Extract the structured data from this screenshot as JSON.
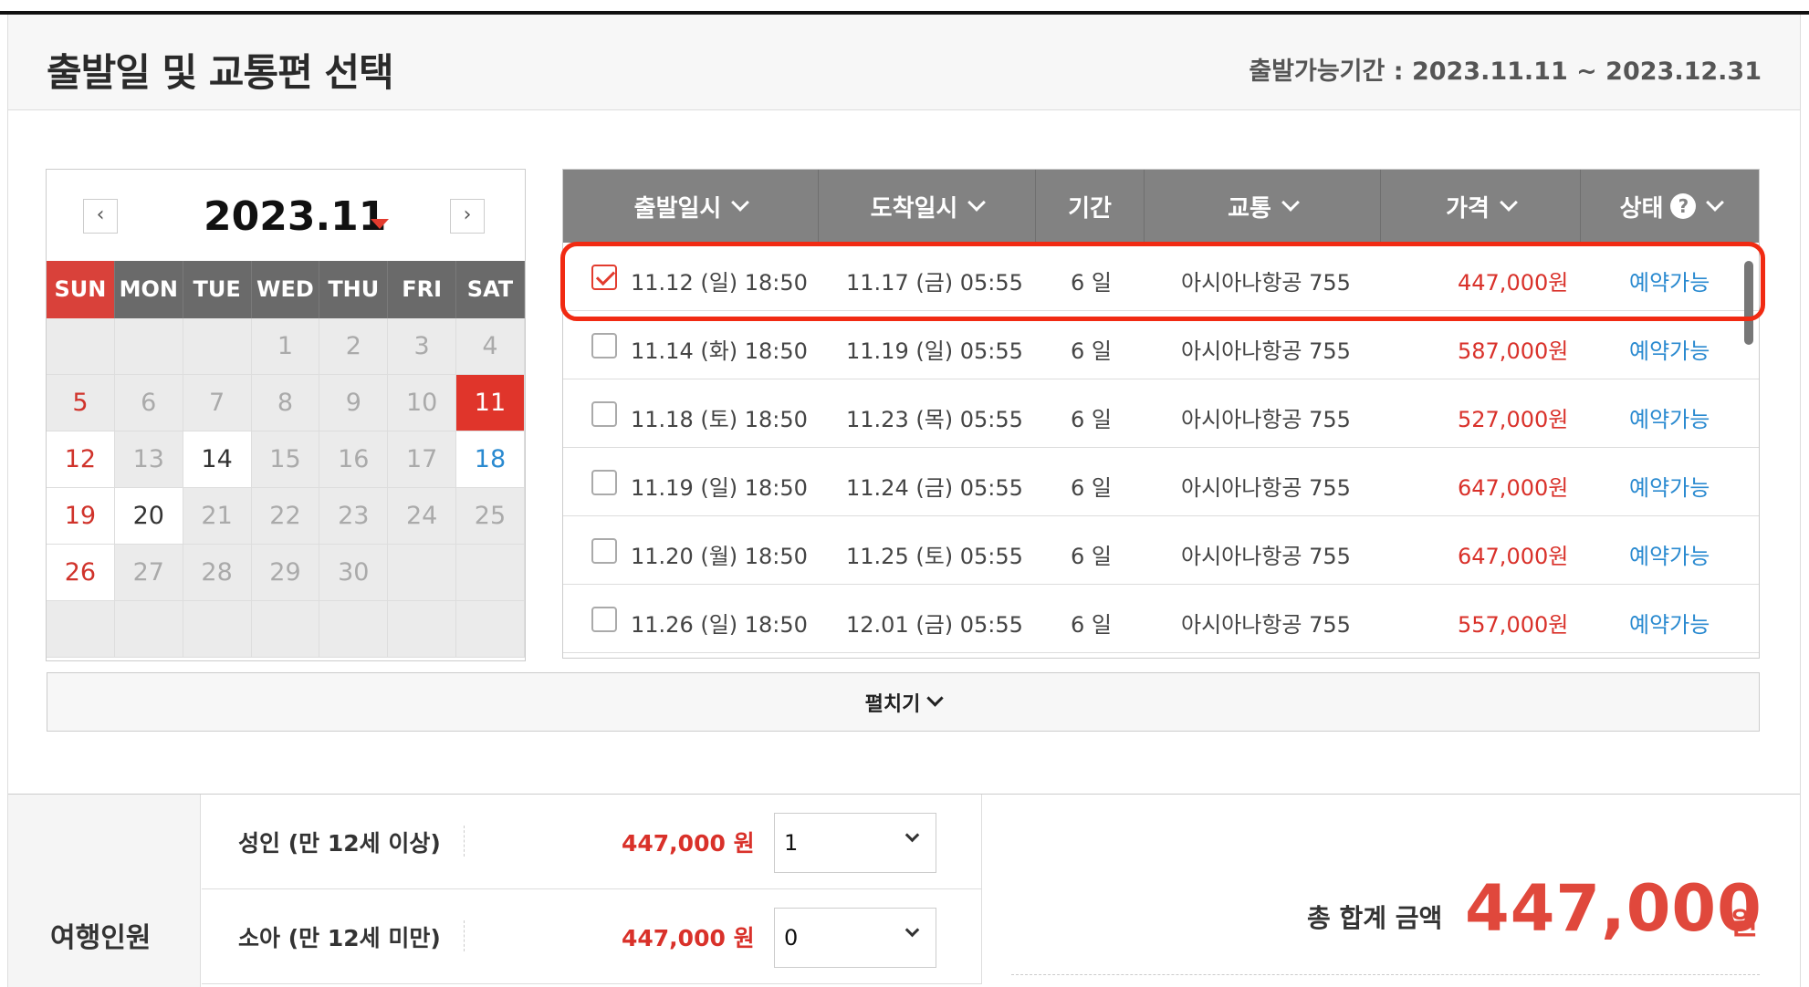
{
  "header": {
    "title": "출발일 및 교통편 선택",
    "period": "출발가능기간 : 2023.11.11 ~ 2023.12.31"
  },
  "calendar": {
    "month": "2023.11",
    "prev": "‹",
    "next": "›",
    "weekdays": [
      "SUN",
      "MON",
      "TUE",
      "WED",
      "THU",
      "FRI",
      "SAT"
    ],
    "weeks": [
      [
        "",
        "",
        "",
        "1",
        "2",
        "3",
        "4"
      ],
      [
        "5",
        "6",
        "7",
        "8",
        "9",
        "10",
        "11"
      ],
      [
        "12",
        "13",
        "14",
        "15",
        "16",
        "17",
        "18"
      ],
      [
        "19",
        "20",
        "21",
        "22",
        "23",
        "24",
        "25"
      ],
      [
        "26",
        "27",
        "28",
        "29",
        "30",
        "",
        ""
      ],
      [
        "",
        "",
        "",
        "",
        "",
        "",
        ""
      ]
    ],
    "selected_day": "11"
  },
  "table": {
    "columns": [
      "출발일시",
      "도착일시",
      "기간",
      "교통",
      "가격",
      "상태"
    ],
    "help": "?",
    "rows": [
      {
        "depart": "11.12 (일) 18:50",
        "arrive": "11.17 (금) 05:55",
        "duration": "6 일",
        "transport": "아시아나항공 755",
        "price": "447,000원",
        "status": "예약가능",
        "checked": true
      },
      {
        "depart": "11.14 (화) 18:50",
        "arrive": "11.19 (일) 05:55",
        "duration": "6 일",
        "transport": "아시아나항공 755",
        "price": "587,000원",
        "status": "예약가능",
        "checked": false
      },
      {
        "depart": "11.18 (토) 18:50",
        "arrive": "11.23 (목) 05:55",
        "duration": "6 일",
        "transport": "아시아나항공 755",
        "price": "527,000원",
        "status": "예약가능",
        "checked": false
      },
      {
        "depart": "11.19 (일) 18:50",
        "arrive": "11.24 (금) 05:55",
        "duration": "6 일",
        "transport": "아시아나항공 755",
        "price": "647,000원",
        "status": "예약가능",
        "checked": false
      },
      {
        "depart": "11.20 (월) 18:50",
        "arrive": "11.25 (토) 05:55",
        "duration": "6 일",
        "transport": "아시아나항공 755",
        "price": "647,000원",
        "status": "예약가능",
        "checked": false
      },
      {
        "depart": "11.26 (일) 18:50",
        "arrive": "12.01 (금) 05:55",
        "duration": "6 일",
        "transport": "아시아나항공 755",
        "price": "557,000원",
        "status": "예약가능",
        "checked": false
      }
    ]
  },
  "expand_label": "펼치기",
  "passengers": {
    "section_label": "여행인원",
    "adult": {
      "label": "성인 (만 12세 이상)",
      "price": "447,000 원",
      "count": "1"
    },
    "child": {
      "label": "소아 (만 12세 미만)",
      "price": "447,000 원",
      "count": "0"
    }
  },
  "total": {
    "label": "총 합계 금액",
    "amount": "447,000",
    "unit": "원"
  },
  "colors": {
    "accent_red": "#e0352b",
    "status_blue": "#2a8ad0",
    "header_gray": "#828282"
  }
}
